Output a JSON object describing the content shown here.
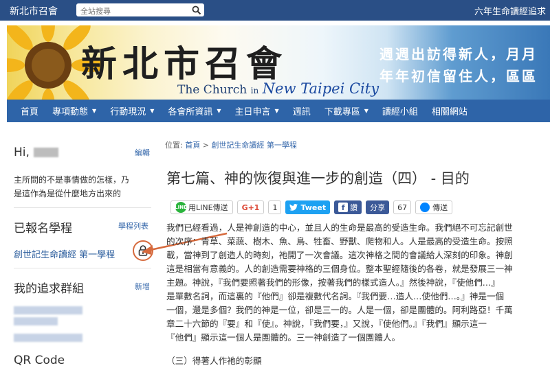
{
  "topbar": {
    "site_name": "新北市召會",
    "search_placeholder": "全站搜尋",
    "right_link": "六年生命讀經追求"
  },
  "banner": {
    "title": "新北市召會",
    "eng_the": "The Church",
    "eng_in": "in",
    "eng_city": "New Taipei City",
    "slogan_line1": "週週出訪得新人，月月",
    "slogan_line2": "年年初信留住人，區區"
  },
  "nav": {
    "items": [
      {
        "label": "首頁",
        "dropdown": false
      },
      {
        "label": "專項動態",
        "dropdown": true
      },
      {
        "label": "行動現況",
        "dropdown": true
      },
      {
        "label": "各會所資訊",
        "dropdown": true
      },
      {
        "label": "主日申言",
        "dropdown": true
      },
      {
        "label": "週訊",
        "dropdown": false
      },
      {
        "label": "下載專區",
        "dropdown": true
      },
      {
        "label": "讀經小組",
        "dropdown": false
      },
      {
        "label": "相關網站",
        "dropdown": false
      }
    ],
    "caret": "▼"
  },
  "sidebar": {
    "greeting": "Hi,",
    "edit_link": "編輯",
    "quote_line1": "主所問的不是事情做的怎樣，乃",
    "quote_line2": "是這作為是從什麼地方出來的",
    "enrolled_title": "已報名學程",
    "enrolled_link": "學程列表",
    "course_name": "創世記生命讀經 第一學程",
    "group_title": "我的追求群組",
    "group_link": "新增",
    "qr_title": "QR Code"
  },
  "breadcrumb": {
    "prefix": "位置:",
    "home": "首頁",
    "sep": ">",
    "current": "創世記生命讀經 第一學程"
  },
  "article": {
    "heading": "第七篇、神的恢復與進一步的創造（四） - 目的",
    "paragraph_lines": [
      "我們已經看過，人是神創造的中心，並且人的生命是最高的受造生命。我們絕不可忘記創世",
      "的次序：青草、菜蔬、樹木、魚、鳥、牲畜、野獸、爬物和人。人是最高的受造生命。按照",
      "載，當神到了創造人的時刻，祂開了一次會議。這次神格之間的會議給人深刻的印象。神創",
      "這是相當有意義的。人的創造需要神格的三個身位。整本聖經隨後的各卷，就是發展三一神",
      "主題。神說，『我們要照著我們的形像，按著我們的樣式造人。』然後神說，『使他們…』",
      "是單數名詞，而這裏的『他們』卻是複數代名詞。『我們要…造人…使他們…。』神是一個",
      "一個，還是多個？我們的神是一位，卻是三一的。人是一個，卻是團體的。阿利路亞！千萬",
      "章二十六節的『要』和『使』。神說，『我們要，』又說，『使他們。』『我們』顯示這一",
      "『他們』顯示這一個人是團體的。三一神創造了一個團體人。"
    ],
    "next_line": "（三）得著人作祂的彰顯"
  },
  "share": {
    "line_label": "用LINE傳送",
    "line_icon_text": "LINE",
    "gplus_label": "G+1",
    "gplus_count": "1",
    "tweet_label": "Tweet",
    "fb_label": "讚",
    "fb_share_label": "分享",
    "fb_count": "67",
    "messenger_label": "傳送"
  }
}
